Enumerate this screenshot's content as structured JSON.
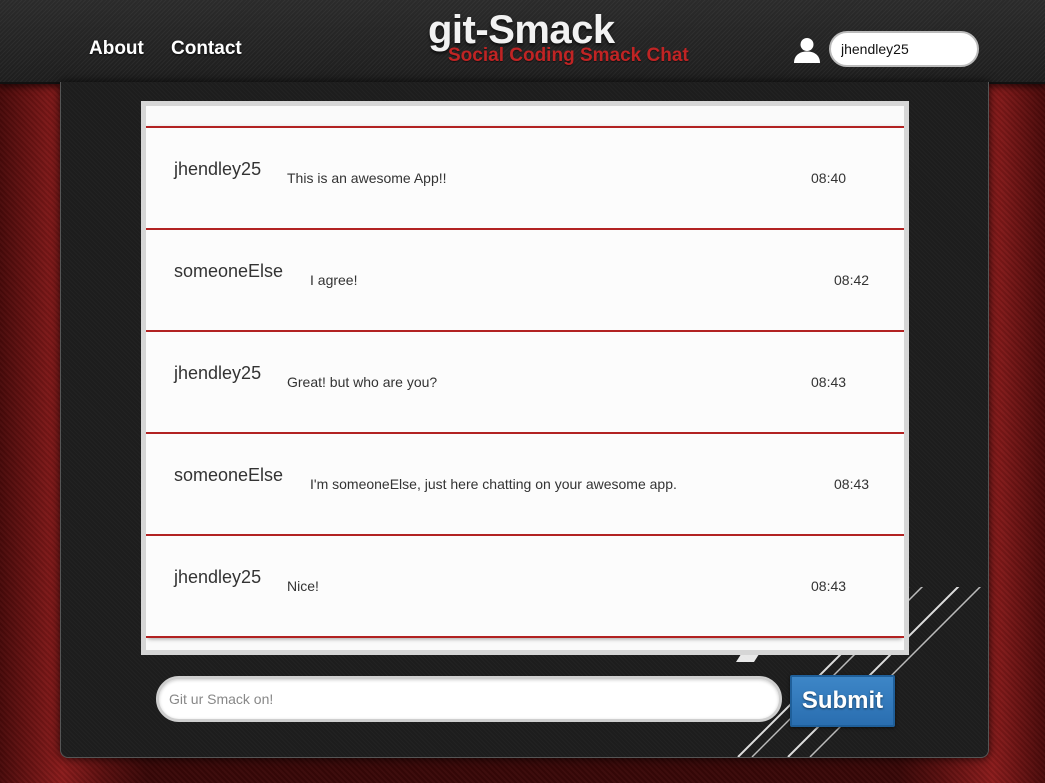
{
  "nav": {
    "about_label": "About",
    "contact_label": "Contact"
  },
  "brand": {
    "title": "git-Smack",
    "subtitle": "Social Coding Smack Chat"
  },
  "user": {
    "icon": "user-icon",
    "username_value": "jhendley25"
  },
  "messages": [
    {
      "user": "jhendley25",
      "text": "This is an awesome App!!",
      "time": "08:40"
    },
    {
      "user": "someoneElse",
      "text": "I agree!",
      "time": "08:42"
    },
    {
      "user": "jhendley25",
      "text": "Great! but who are you?",
      "time": "08:43"
    },
    {
      "user": "someoneElse",
      "text": "I'm someoneElse, just here chatting on your awesome app.",
      "time": "08:43"
    },
    {
      "user": "jhendley25",
      "text": "Nice!",
      "time": "08:43"
    }
  ],
  "composer": {
    "placeholder": "Git ur Smack on!",
    "submit_label": "Submit"
  },
  "colors": {
    "accent_red": "#b22222",
    "submit_blue": "#2a6eb0",
    "brand_sub_red": "#c02424"
  }
}
